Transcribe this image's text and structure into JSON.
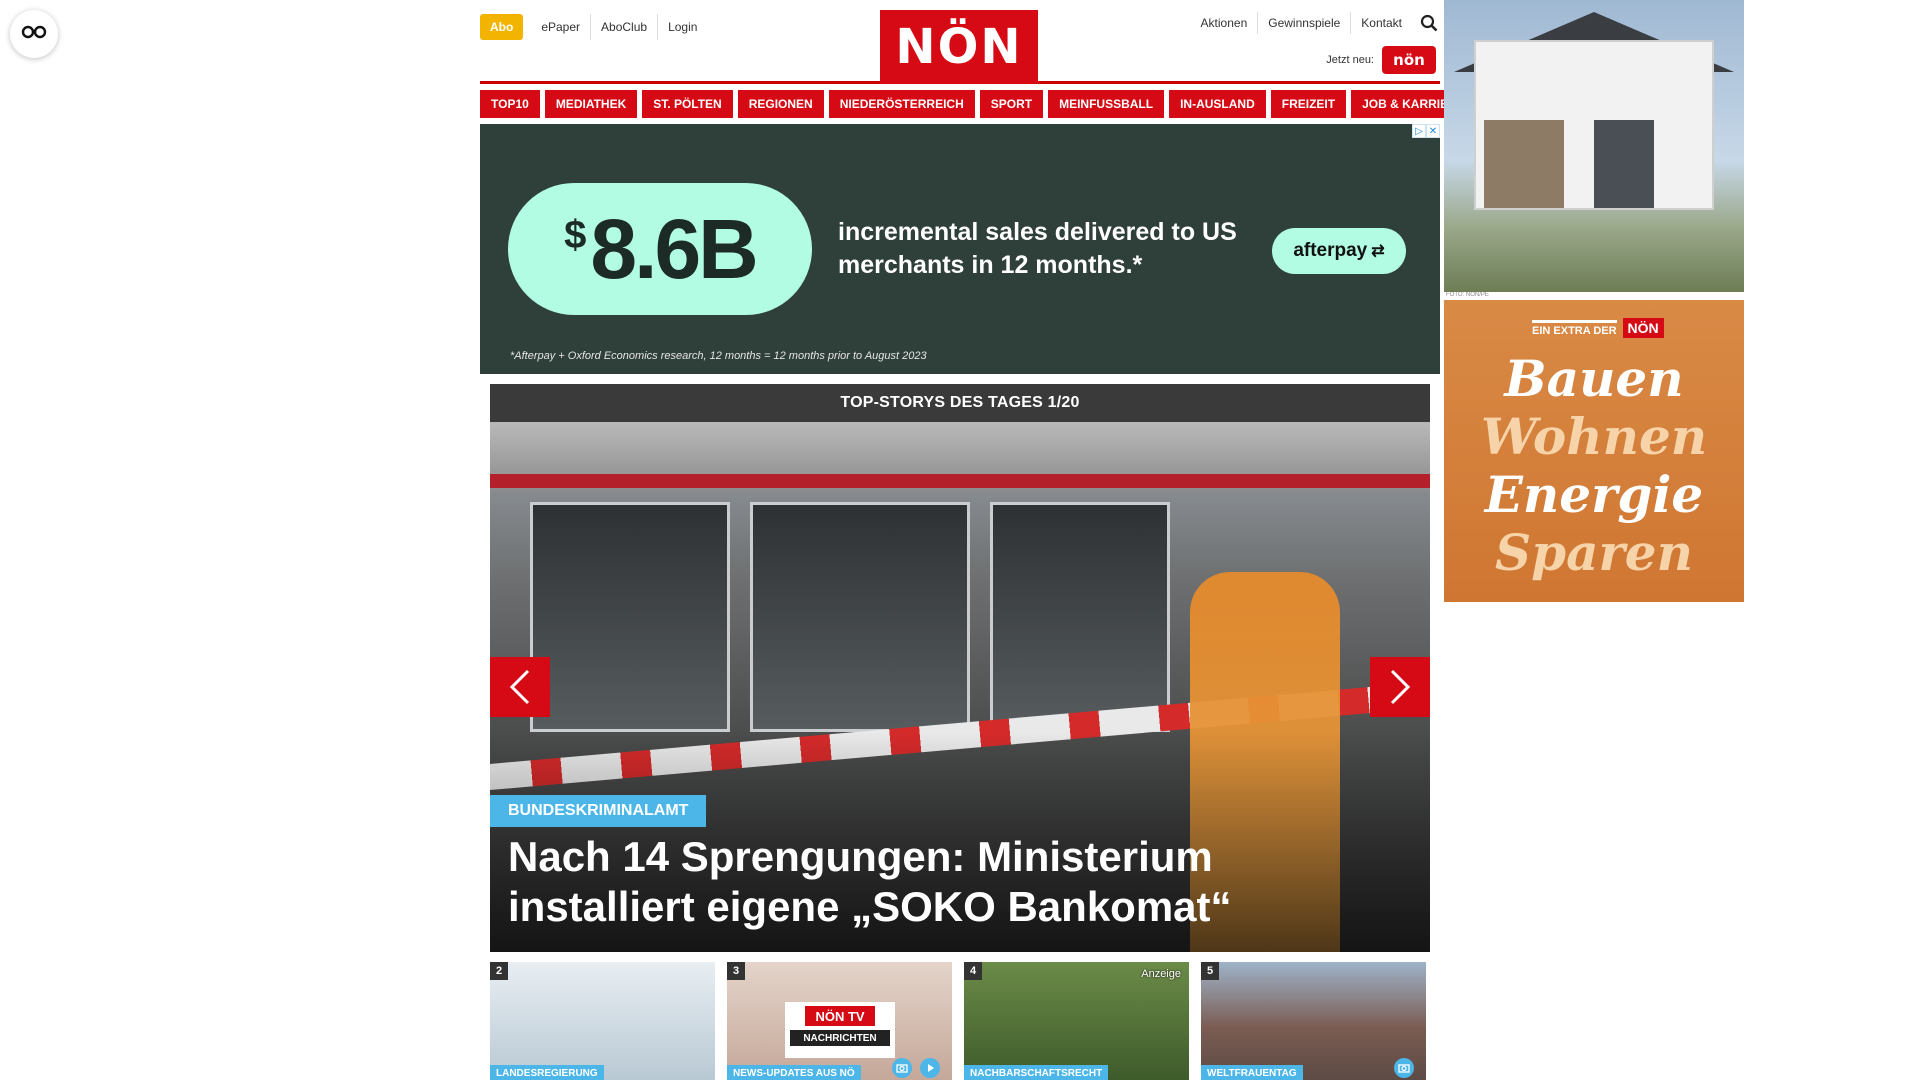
{
  "header": {
    "abo_label": "Abo",
    "top_links": [
      "ePaper",
      "AboClub",
      "Login"
    ],
    "logo_text": "NÖN",
    "right_links": [
      "Aktionen",
      "Gewinnspiele",
      "Kontakt"
    ],
    "jetzt_label": "Jetzt neu:",
    "jetzt_badge": "nön"
  },
  "nav": {
    "items": [
      "TOP10",
      "MEDIATHEK",
      "ST. PÖLTEN",
      "REGIONEN",
      "NIEDERÖSTERREICH",
      "SPORT",
      "MEINFUSSBALL",
      "IN-AUSLAND",
      "FREIZEIT",
      "JOB & KARRIERE"
    ]
  },
  "ad_banner": {
    "currency": "$",
    "amount": "8.6B",
    "text": "incremental sales delivered to US merchants in 12 months.*",
    "cta": "afterpay",
    "footnote": "*Afterpay + Oxford Economics research, 12 months = 12 months prior to August 2023",
    "colors": {
      "background": "#2f3f3a",
      "mint": "#b2fce4"
    }
  },
  "stories": {
    "heading": "TOP-STORYS DES TAGES 1/20",
    "hero": {
      "tag": "BUNDESKRIMINALAMT",
      "title": "Nach 14 Sprengungen: Ministerium installiert eigene „SOKO Bankomat“"
    },
    "thumbs": [
      {
        "num": "2",
        "tag": "LANDESREGIERUNG"
      },
      {
        "num": "3",
        "tag": "NEWS-UPDATES AUS NÖ",
        "tv_logo": "NÖN TV",
        "tv_sub": "NACHRICHTEN"
      },
      {
        "num": "4",
        "tag": "NACHBARSCHAFTSRECHT",
        "badge": "Anzeige"
      },
      {
        "num": "5",
        "tag": "WELTFRAUENTAG"
      }
    ]
  },
  "right_ads": {
    "photo_credit": "FOTO: NÖN/PE",
    "extra_label": "EIN EXTRA DER",
    "extra_logo": "NÖN",
    "words": [
      "Bauen",
      "Wohnen",
      "Energie",
      "Sparen"
    ]
  },
  "colors": {
    "brand_red": "#d60a14",
    "abo_yellow": "#f2b400",
    "tag_blue": "#4db6e8"
  }
}
